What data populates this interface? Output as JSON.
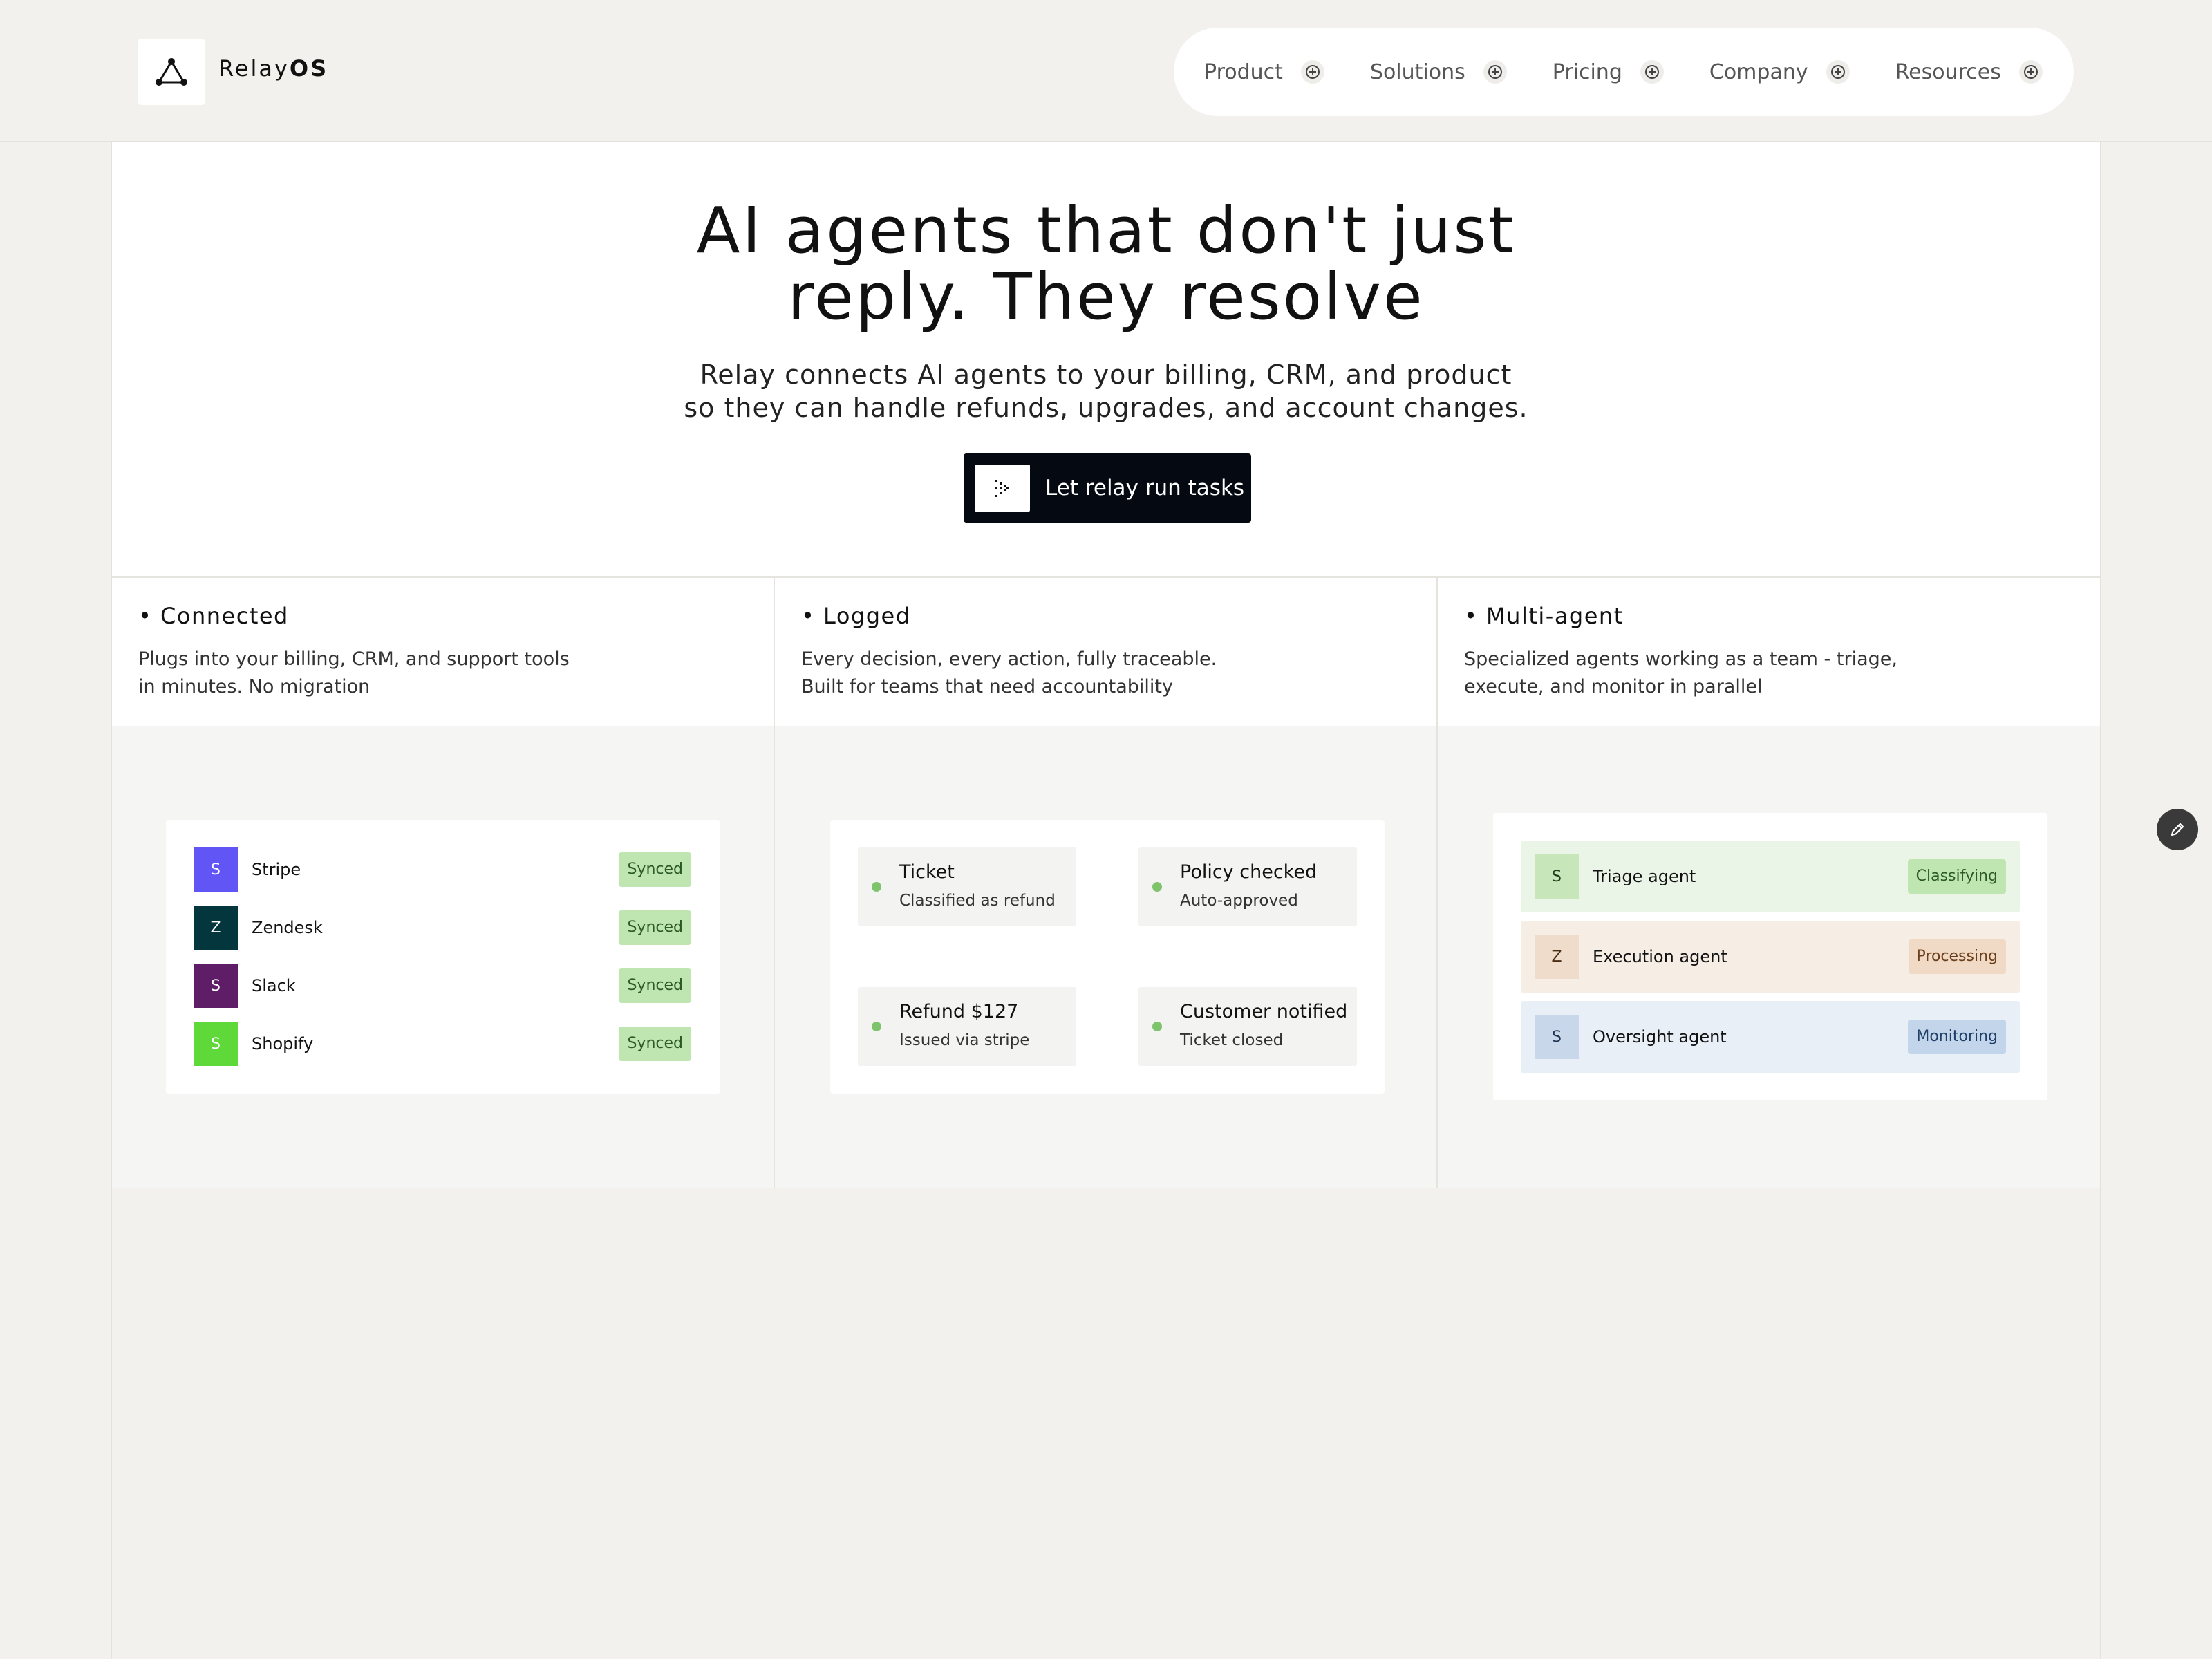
{
  "header": {
    "brand_prefix": "Relay",
    "brand_suffix": "OS",
    "nav": [
      {
        "label": "Product"
      },
      {
        "label": "Solutions"
      },
      {
        "label": "Pricing"
      },
      {
        "label": "Company"
      },
      {
        "label": "Resources"
      }
    ]
  },
  "hero": {
    "title_line1": "AI agents that don't just",
    "title_line2": "reply. They resolve",
    "subtitle_line1": "Relay connects AI agents to your billing, CRM, and product",
    "subtitle_line2": "so they can handle refunds, upgrades, and account changes.",
    "cta_label": "Let relay run tasks"
  },
  "features": [
    {
      "title": "• Connected",
      "desc_line1": "Plugs into your billing, CRM, and support tools",
      "desc_line2": "in minutes. No migration"
    },
    {
      "title": "• Logged",
      "desc_line1": "Every decision, every action, fully traceable.",
      "desc_line2": "Built for teams that need accountability"
    },
    {
      "title": "• Multi-agent",
      "desc_line1": "Specialized agents working as a team - triage,",
      "desc_line2": "execute, and monitor in parallel"
    }
  ],
  "integrations": [
    {
      "initial": "S",
      "name": "Stripe",
      "status": "Synced",
      "color": "#6155f5"
    },
    {
      "initial": "Z",
      "name": "Zendesk",
      "status": "Synced",
      "color": "#04363d"
    },
    {
      "initial": "S",
      "name": "Slack",
      "status": "Synced",
      "color": "#5f1c67"
    },
    {
      "initial": "S",
      "name": "Shopify",
      "status": "Synced",
      "color": "#5fd83a"
    }
  ],
  "log_steps": [
    {
      "title": "Ticket",
      "sub": "Classified as refund"
    },
    {
      "title": "Policy checked",
      "sub": "Auto-approved"
    },
    {
      "title": "Refund $127",
      "sub": "Issued via stripe"
    },
    {
      "title": "Customer notified",
      "sub": "Ticket closed"
    }
  ],
  "agents": [
    {
      "initial": "S",
      "name": "Triage agent",
      "status": "Classifying",
      "row_color": "#ebf5e7",
      "av_color": "#c7e7bb",
      "badge_bg": "#bfe5b0",
      "badge_fg": "#2b5a26"
    },
    {
      "initial": "Z",
      "name": "Execution agent",
      "status": "Processing",
      "row_color": "#f6ede5",
      "av_color": "#efdccb",
      "badge_bg": "#f0d9c5",
      "badge_fg": "#6a3f1c"
    },
    {
      "initial": "S",
      "name": "Oversight agent",
      "status": "Monitoring",
      "row_color": "#e8eff7",
      "av_color": "#c8d8ea",
      "badge_bg": "#c3d5ea",
      "badge_fg": "#1f3f66"
    }
  ]
}
